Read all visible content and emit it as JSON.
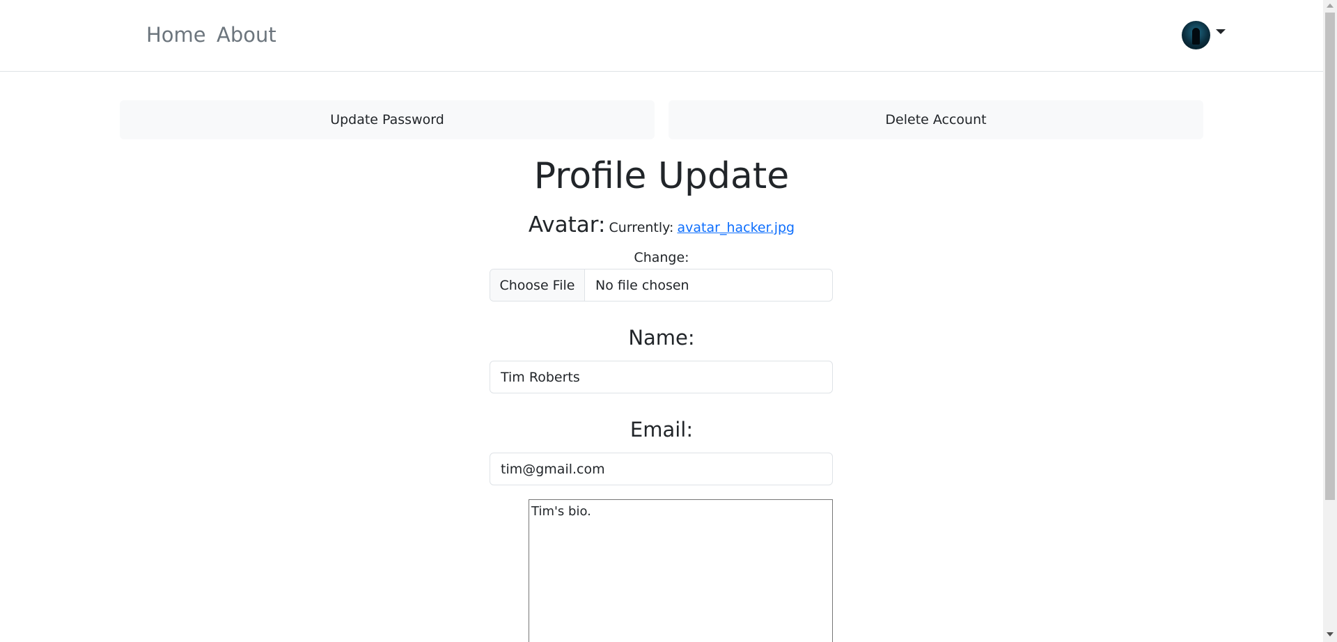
{
  "nav": {
    "home_label": "Home",
    "about_label": "About"
  },
  "actions": {
    "update_password_label": "Update Password",
    "delete_account_label": "Delete Account"
  },
  "page": {
    "title": "Profile Update"
  },
  "avatar": {
    "label": "Avatar:",
    "currently_label": "Currently:",
    "current_file": "avatar_hacker.jpg",
    "change_label": "Change:",
    "choose_file_label": "Choose File",
    "file_status": "No file chosen"
  },
  "form": {
    "name_label": "Name:",
    "name_value": "Tim Roberts",
    "email_label": "Email:",
    "email_value": "tim@gmail.com",
    "bio_value": "Tim's bio."
  },
  "colors": {
    "link": "#0d6efd",
    "nav_text": "#6c757d",
    "button_bg": "#f8f9fa"
  }
}
